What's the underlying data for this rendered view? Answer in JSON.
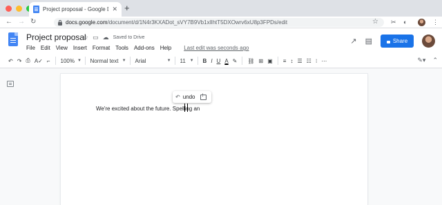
{
  "browser": {
    "tab_title": "Project proposal - Google Docs",
    "tab_close": "✕",
    "new_tab": "+",
    "url_host": "docs.google.com",
    "url_path": "/document/d/1N4r3KXADot_sVY7B9Vb1xIlhtT5DXOwrv6xU8p3FPDs/edit",
    "light_colors": [
      "#fe5f57",
      "#febc2e",
      "#28c840"
    ]
  },
  "doc": {
    "title": "Project proposal",
    "saved": "Saved to Drive",
    "menu": [
      "File",
      "Edit",
      "View",
      "Insert",
      "Format",
      "Tools",
      "Add-ons",
      "Help"
    ],
    "last_edit": "Last edit was seconds ago",
    "share": "Share"
  },
  "toolbar": {
    "zoom": "100%",
    "style": "Normal text",
    "font": "Arial",
    "size": "11",
    "bold": "B",
    "italic": "I",
    "underline": "U",
    "text_color": "A"
  },
  "popup": {
    "undo": "undo"
  },
  "body": {
    "text": "We're excited about the future. Spelling an"
  },
  "accent": "#1a73e8"
}
